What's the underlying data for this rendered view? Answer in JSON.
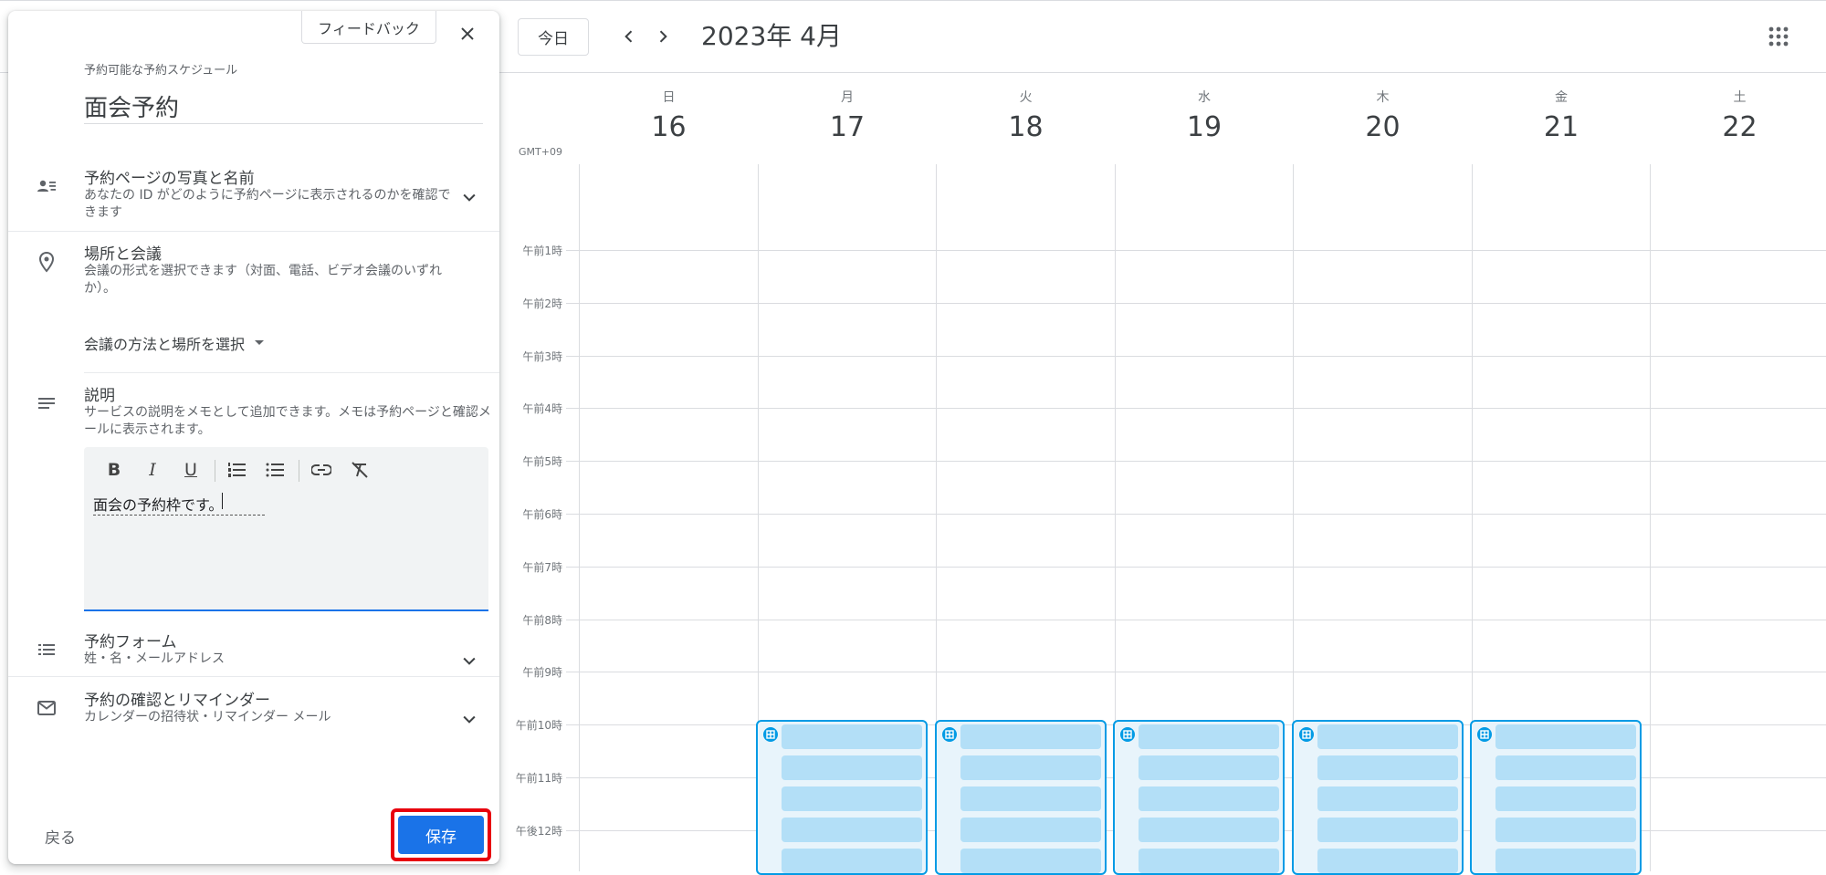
{
  "calendar": {
    "today_label": "今日",
    "month_title": "2023年 4月",
    "timezone": "GMT+09",
    "days": [
      {
        "name": "日",
        "num": "16"
      },
      {
        "name": "月",
        "num": "17"
      },
      {
        "name": "火",
        "num": "18"
      },
      {
        "name": "水",
        "num": "19"
      },
      {
        "name": "木",
        "num": "20"
      },
      {
        "name": "金",
        "num": "21"
      },
      {
        "name": "土",
        "num": "22"
      }
    ],
    "hours": [
      "午前1時",
      "午前2時",
      "午前3時",
      "午前4時",
      "午前5時",
      "午前6時",
      "午前7時",
      "午前8時",
      "午前9時",
      "午前10時",
      "午前11時",
      "午後12時"
    ],
    "slot_days": [
      "17",
      "18",
      "19",
      "20",
      "21"
    ],
    "slot_start": "午前10時"
  },
  "panel": {
    "feedback_label": "フィードバック",
    "kicker": "予約可能な予約スケジュール",
    "title": "面会予約",
    "sections": {
      "photo": {
        "title": "予約ページの写真と名前",
        "sub": "あなたの ID がどのように予約ページに表示されるのかを確認できます"
      },
      "location": {
        "title": "場所と会議",
        "sub": "会議の形式を選択できます（対面、電話、ビデオ会議のいずれか）。",
        "select_label": "会議の方法と場所を選択"
      },
      "description": {
        "title": "説明",
        "sub": "サービスの説明をメモとして追加できます。メモは予約ページと確認メールに表示されます。",
        "text": "面会の予約枠です。"
      },
      "form": {
        "title": "予約フォーム",
        "sub": "姓・名・メールアドレス"
      },
      "reminders": {
        "title": "予約の確認とリマインダー",
        "sub": "カレンダーの招待状・リマインダー メール"
      }
    },
    "back_label": "戻る",
    "save_label": "保存"
  },
  "colors": {
    "accent": "#1a73e8",
    "slot_border": "#039be5",
    "slot_fill": "#b3dff7",
    "highlight": "#e8000d"
  }
}
